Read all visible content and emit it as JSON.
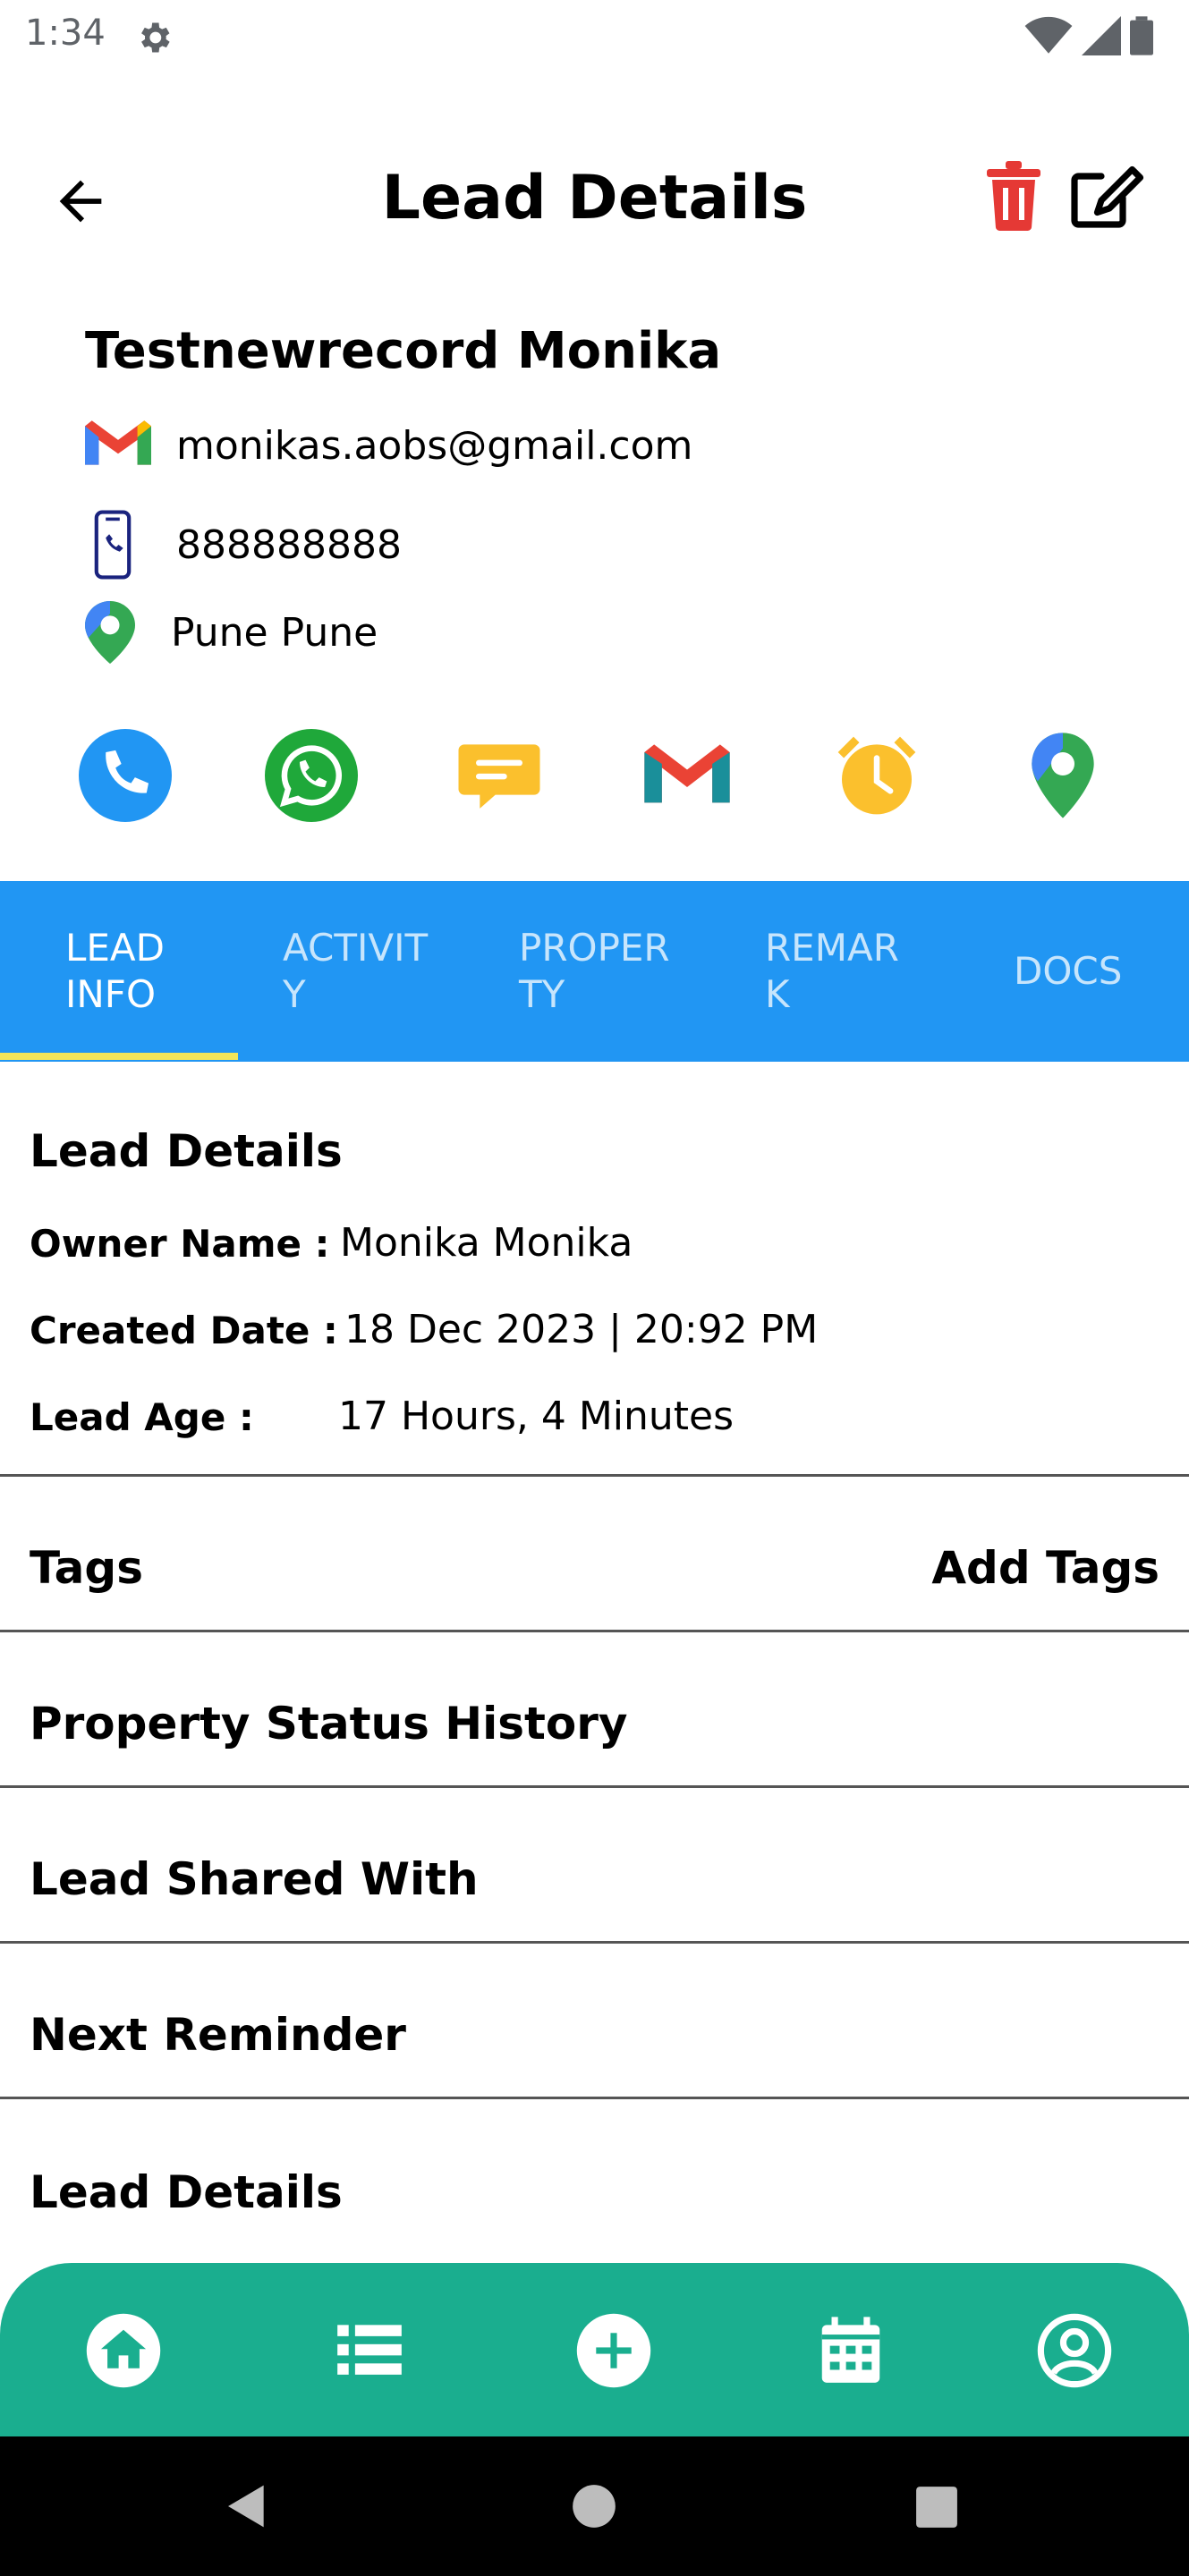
{
  "status_bar": {
    "time": "1:34"
  },
  "header": {
    "title": "Lead Details"
  },
  "contact": {
    "name": "Testnewrecord Monika",
    "email": "monikas.aobs@gmail.com",
    "phone": "888888888",
    "location": "Pune Pune"
  },
  "actions": [
    "phone-call",
    "whatsapp",
    "sms-message",
    "gmail",
    "reminder-alarm",
    "map-location"
  ],
  "tabs": [
    {
      "label": "LEAD\nINFO",
      "active": true
    },
    {
      "label": "ACTIVIT\nY",
      "active": false
    },
    {
      "label": "PROPER\nTY",
      "active": false
    },
    {
      "label": "REMAR\nK",
      "active": false
    },
    {
      "label": "DOCS",
      "active": false
    }
  ],
  "lead_info": {
    "section_title": "Lead Details",
    "owner_label": "Owner Name :",
    "owner_value": "Monika Monika",
    "created_label": "Created Date :",
    "created_value": "18 Dec 2023 | 20:92 PM",
    "age_label": "Lead Age :",
    "age_value": "17 Hours, 4 Minutes"
  },
  "sections": {
    "tags": "Tags",
    "add_tags": "Add Tags",
    "property_status_history": "Property Status History",
    "lead_shared_with": "Lead Shared With",
    "next_reminder": "Next Reminder",
    "lead_details": "Lead Details"
  },
  "bottom_nav": [
    "home",
    "list",
    "add",
    "calendar",
    "profile"
  ],
  "colors": {
    "tab_bar": "#2196f3",
    "tab_indicator": "#f3e55a",
    "bottom_nav": "#1aae8f",
    "delete_icon": "#e53935"
  }
}
